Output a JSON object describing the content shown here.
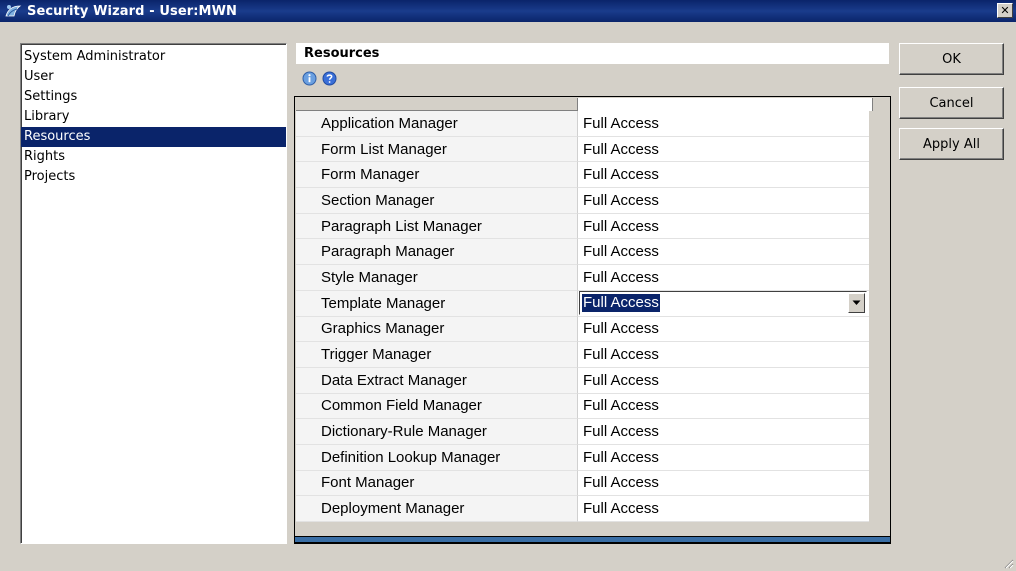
{
  "window": {
    "title": "Security Wizard - User:MWN",
    "close_label": "✕"
  },
  "nav": {
    "items": [
      {
        "label": "System Administrator"
      },
      {
        "label": "User"
      },
      {
        "label": "Settings"
      },
      {
        "label": "Library"
      },
      {
        "label": "Resources",
        "selected": true
      },
      {
        "label": "Rights"
      },
      {
        "label": "Projects"
      }
    ]
  },
  "resources": {
    "title": "Resources",
    "icons": [
      "info-icon",
      "help-icon"
    ],
    "rows": [
      {
        "name": "Application Manager",
        "access": "Full Access"
      },
      {
        "name": "Form List Manager",
        "access": "Full Access"
      },
      {
        "name": "Form Manager",
        "access": "Full Access"
      },
      {
        "name": "Section Manager",
        "access": "Full Access"
      },
      {
        "name": "Paragraph List Manager",
        "access": "Full Access"
      },
      {
        "name": "Paragraph Manager",
        "access": "Full Access"
      },
      {
        "name": "Style Manager",
        "access": "Full Access"
      },
      {
        "name": "Template Manager",
        "access": "Full Access",
        "editing": true
      },
      {
        "name": "Graphics Manager",
        "access": "Full Access"
      },
      {
        "name": "Trigger Manager",
        "access": "Full Access"
      },
      {
        "name": "Data Extract Manager",
        "access": "Full Access"
      },
      {
        "name": "Common Field Manager",
        "access": "Full Access"
      },
      {
        "name": "Dictionary-Rule Manager",
        "access": "Full Access"
      },
      {
        "name": "Definition Lookup Manager",
        "access": "Full Access"
      },
      {
        "name": "Font Manager",
        "access": "Full Access"
      },
      {
        "name": "Deployment Manager",
        "access": "Full Access"
      }
    ]
  },
  "buttons": {
    "ok": "OK",
    "cancel": "Cancel",
    "apply_all": "Apply All"
  },
  "colors": {
    "titlebar": "#0a246a",
    "selection": "#0a246a",
    "dialog_bg": "#d4d0c8"
  }
}
